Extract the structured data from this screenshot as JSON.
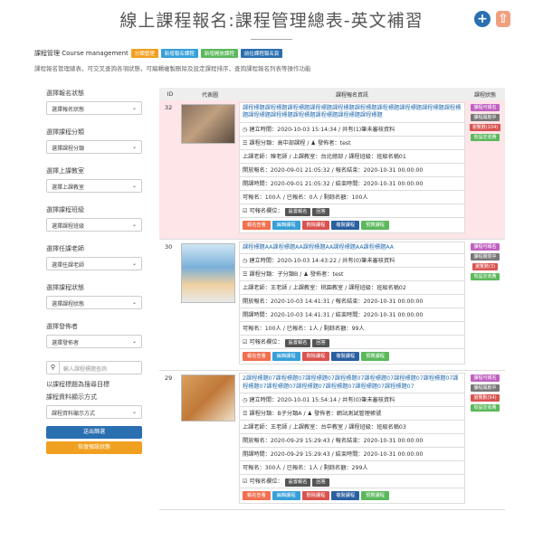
{
  "header": {
    "title": "線上課程報名:課程管理總表-英文補習",
    "add_icon": "plus-circle-icon",
    "up_icon": "arrow-up-icon"
  },
  "breadcrumb": {
    "label": "課程管理 Course management",
    "tags": [
      {
        "text": "分類管理",
        "color": "#f0a020"
      },
      {
        "text": "新增報名課程",
        "color": "#37a0d8"
      },
      {
        "text": "新增開放課程",
        "color": "#5cb85c"
      },
      {
        "text": "前往課程報名頁",
        "color": "#2a6fb0"
      }
    ]
  },
  "description": "課程報名管理總表，可交叉查詢各項狀態，可編輯複製刪除及設定課程排序，查詢課程報名列表等操作功能",
  "sidebar": {
    "filters": [
      {
        "label": "選擇報名狀態",
        "value": "選擇報名狀態"
      },
      {
        "label": "選擇課程分類",
        "value": "選擇課程分類"
      },
      {
        "label": "選擇上課教室",
        "value": "選擇上課教室"
      },
      {
        "label": "選擇課程班級",
        "value": "選擇課程班級"
      },
      {
        "label": "選擇任課老師",
        "value": "選擇任課老師"
      },
      {
        "label": "選擇課程狀態",
        "value": "選擇課程狀態"
      },
      {
        "label": "選擇發佈者",
        "value": "選擇發佈者"
      }
    ],
    "search_placeholder": "輸入課程標題查詢",
    "search_hint": "以課程標題為搜尋目標",
    "order_label": "課程資料顯示方式",
    "order_value": "課程資料顯示方式",
    "submit": "送出篩選",
    "reset": "恢復預設狀態"
  },
  "table": {
    "headers": [
      "ID",
      "代表圖",
      "課程報名資訊",
      "課程狀態"
    ],
    "rows": [
      {
        "id": "32",
        "title": "課程標題課程標題課程標題課程標題課程標題課程標題課程標題課程標題課程標題課程標題課程標題課程標題課程標題課程標題課程標題課程標題",
        "created": "建立時間：2020-10-03 15:14:34 / 共有(1)筆未審核資料",
        "category": "課程分類：高中部課程 / ",
        "publisher": "發佈者：test",
        "teacher": "上課老師：陳老師 / 上課教室：台北總部 / 課程班級：班級名稱01",
        "signup": "開放報名：2020-09-01 21:05:32 / 報名結束：2020-10-31 00:00:00",
        "open": "開課時間：2020-09-01 21:05:32 / 結束時間：2020-10-31 00:00:00",
        "counts": "可報名：100人 / 已報名：0人 / 剩餘名額：100人",
        "fields": "可報名欄位：",
        "badges": [
          {
            "text": "課程可報名",
            "color": "#c060c0"
          },
          {
            "text": "課程開啟中",
            "color": "#777777"
          },
          {
            "text": "瀏覽數(104)",
            "color": "#d9534f"
          },
          {
            "text": "有設定收費",
            "color": "#5cb85c"
          }
        ]
      },
      {
        "id": "30",
        "title": "課程標題AA課程標題AA課程標題AA課程標題AA課程標題AA",
        "created": "建立時間：2020-10-03 14:43:22 / 共有(0)筆未審核資料",
        "category": "課程分類：子分類B / ",
        "publisher": "發佈者：test",
        "teacher": "上課老師：王老師 / 上課教室：桃園教室 / 課程班級：班級名稱02",
        "signup": "開放報名：2020-10-03 14:41:31 / 報名結束：2020-10-31 00:00:00",
        "open": "開課時間：2020-10-03 14:41:31 / 結束時間：2020-10-31 00:00:00",
        "counts": "可報名：100人 / 已報名：1人 / 剩餘名額：99人",
        "fields": "可報名欄位：",
        "badges": [
          {
            "text": "課程可報名",
            "color": "#c060c0"
          },
          {
            "text": "課程關閉中",
            "color": "#777777"
          },
          {
            "text": "瀏覽數(3)",
            "color": "#d9534f"
          },
          {
            "text": "有設定收費",
            "color": "#5cb85c"
          }
        ]
      },
      {
        "id": "29",
        "title": "2課程標題07課程標題07課程標題07課程標題07課程標題07課程標題07課程標題07課程標題07課程標題07課程標題07課程標題07課程標題07課程標題07",
        "created": "建立時間：2020-10-01 15:54:14 / 共有(0)筆未審核資料",
        "category": "課程分類：B子分類A / ",
        "publisher": "發佈者：網站測試管理帳號",
        "teacher": "上課老師：王老師 / 上課教室：台中教室 / 課程班級：班級名稱03",
        "signup": "開放報名：2020-09-29 15:29:43 / 報名結束：2020-10-31 00:00:00",
        "open": "開課時間：2020-09-29 15:29:43 / 結束時間：2020-10-31 00:00:00",
        "counts": "可報名：300人 / 已報名：1人 / 剩餘名額：299人",
        "fields": "可報名欄位：",
        "badges": [
          {
            "text": "課程可報名",
            "color": "#c060c0"
          },
          {
            "text": "課程開啟中",
            "color": "#777777"
          },
          {
            "text": "瀏覽數(94)",
            "color": "#d9534f"
          },
          {
            "text": "有設定收費",
            "color": "#5cb85c"
          }
        ]
      }
    ],
    "small_buttons": [
      "設置報名",
      "回答"
    ],
    "actions": [
      {
        "text": "報名查看",
        "color": "#f07050"
      },
      {
        "text": "編輯課程",
        "color": "#37a0d8"
      },
      {
        "text": "刪除課程",
        "color": "#d9534f"
      },
      {
        "text": "複製課程",
        "color": "#2a5fa0"
      },
      {
        "text": "預覽課程",
        "color": "#5cb85c"
      }
    ]
  }
}
